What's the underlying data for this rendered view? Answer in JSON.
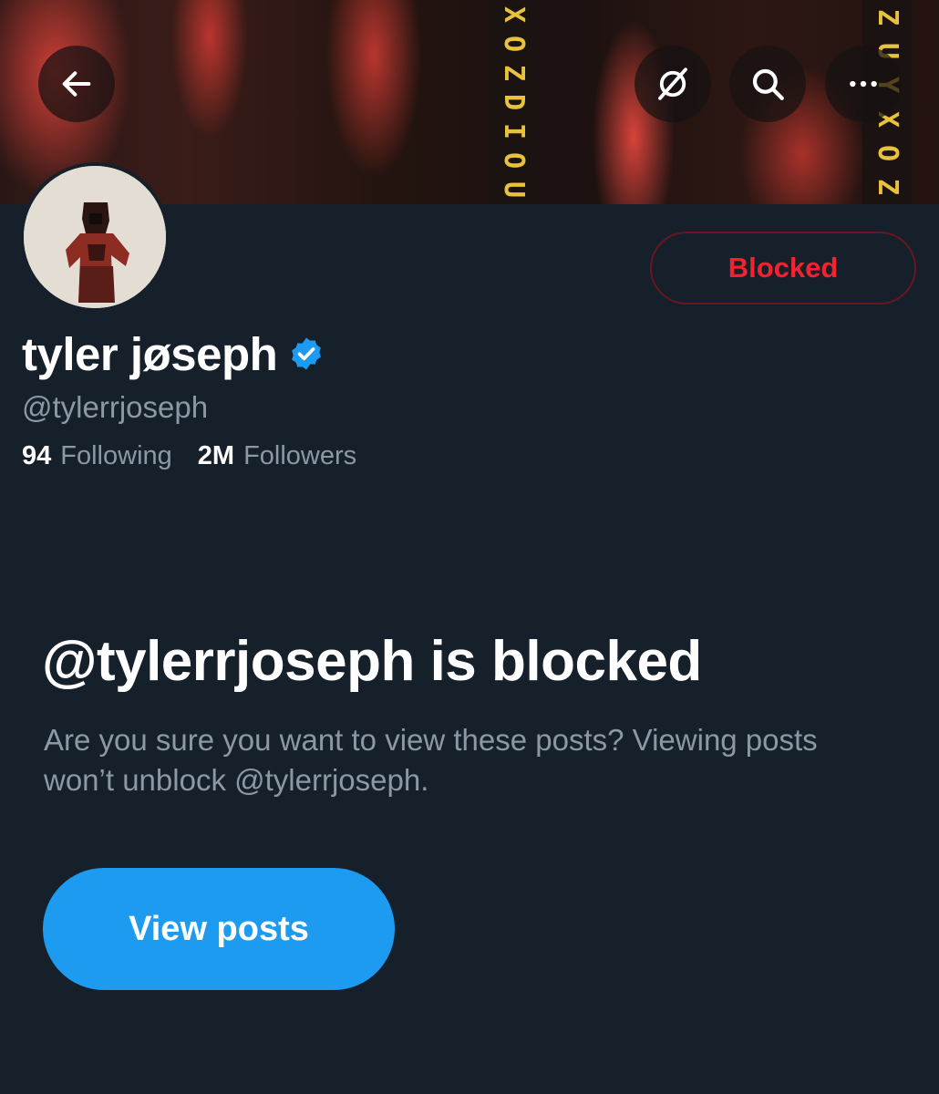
{
  "header": {
    "banner_glyphs_left": [
      "X",
      "O",
      "Z",
      "D",
      "I",
      "O",
      "U"
    ],
    "banner_glyphs_right": [
      "Z",
      "U",
      "Y",
      "X",
      "O",
      "Z"
    ],
    "back_icon": "arrow-left-icon",
    "no_notify_icon": "bell-off-icon",
    "search_icon": "search-icon",
    "more_icon": "more-horizontal-icon"
  },
  "profile": {
    "display_name": "tyler jøseph",
    "verified": true,
    "handle": "@tylerrjoseph",
    "following_count": "94",
    "following_label": "Following",
    "followers_count": "2M",
    "followers_label": "Followers",
    "blocked_button_label": "Blocked"
  },
  "blocked_notice": {
    "title": "@tylerrjoseph is blocked",
    "description": "Are you sure you want to view these posts? Viewing posts won’t unblock @tylerrjoseph.",
    "view_posts_label": "View posts"
  },
  "colors": {
    "background": "#16202b",
    "accent_blue": "#1d9bf0",
    "blocked_red": "#f4212e",
    "muted_text": "#8b98a5",
    "banner_yellow": "#e8c23a"
  }
}
